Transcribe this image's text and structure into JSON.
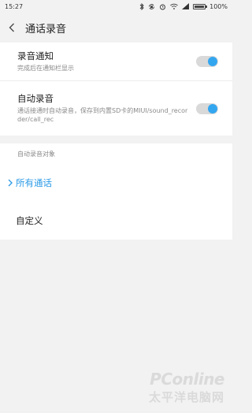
{
  "status_bar": {
    "time": "15:27",
    "battery_percent": "100%",
    "battery_level": 1.0
  },
  "header": {
    "title": "通话录音"
  },
  "settings": [
    {
      "title": "录音通知",
      "subtitle": "完成后在通知栏显示",
      "enabled": true
    },
    {
      "title": "自动录音",
      "subtitle": "通话接通时自动录音，保存到内置SD卡的MIUI/sound_recorder/call_rec",
      "enabled": true
    }
  ],
  "auto_record_section": {
    "header": "自动录音对象",
    "options": [
      {
        "label": "所有通话",
        "selected": true
      },
      {
        "label": "自定义",
        "selected": false
      }
    ]
  },
  "watermark": {
    "brand": "PConline",
    "sub": "太平洋电脑网"
  },
  "colors": {
    "accent": "#2a9ae6",
    "toggle_knob": "#33a6f0",
    "background": "#f2f2f2"
  }
}
